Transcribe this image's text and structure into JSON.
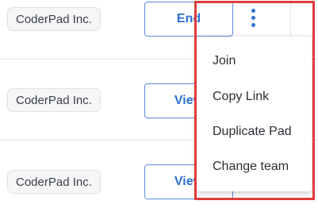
{
  "rows": [
    {
      "org": "CoderPad Inc.",
      "action": "End"
    },
    {
      "org": "CoderPad Inc.",
      "action": "View"
    },
    {
      "org": "CoderPad Inc.",
      "action": "View"
    }
  ],
  "more_button": {
    "icon": "kebab-vertical-icon"
  },
  "menu": {
    "items": [
      "Join",
      "Copy Link",
      "Duplicate Pad",
      "Change team"
    ]
  },
  "colors": {
    "accent": "#2f6fd1",
    "highlight": "#e03b3b",
    "divider": "#e4e6ea"
  }
}
